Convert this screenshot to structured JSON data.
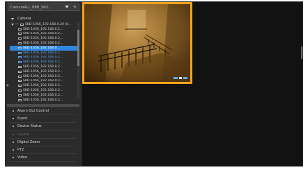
{
  "search": {
    "text": "CameraALL_BBB_SKU..."
  },
  "camera_section": {
    "label": "Camera"
  },
  "tree": {
    "group_label": "SKD-1056_192.168.0.20 (0...",
    "items": [
      {
        "label": "SKD-1056_192.168.0.2...",
        "state": "normal"
      },
      {
        "label": "SKD-1056_192.168.0.2...",
        "state": "normal"
      },
      {
        "label": "SKD-1056_192.168.0.2...",
        "state": "normal"
      },
      {
        "label": "SKD-1056_192.168.0.2...",
        "state": "normal"
      },
      {
        "label": "SKD-1056_192.168.0...",
        "state": "selected"
      },
      {
        "label": "SKD-1056_192.168.0.2...",
        "state": "blue"
      },
      {
        "label": "SKD-1056_192.168.0.2...",
        "state": "blue"
      },
      {
        "label": "SKD-1056_192.168.0.2...",
        "state": "blue"
      },
      {
        "label": "SKD-1056_192.168.0.2...",
        "state": "normal"
      },
      {
        "label": "SKD-1056_192.168.0.2...",
        "state": "normal"
      },
      {
        "label": "SKD-1056_192.168.0.2...",
        "state": "normal"
      },
      {
        "label": "SKD-1056_192.168.0.2...",
        "state": "normal"
      },
      {
        "label": "SKD-1056_192.168.0.2...",
        "state": "normal"
      },
      {
        "label": "SKD-1056_192.168.0.2...",
        "state": "normal"
      },
      {
        "label": "SKD-1056_192.168.0.2...",
        "state": "normal"
      },
      {
        "label": "SKD-1056_192.168.0.2...",
        "state": "normal"
      }
    ]
  },
  "accordion": [
    {
      "label": "Alarm Out Control",
      "disabled": false
    },
    {
      "label": "Event",
      "disabled": false
    },
    {
      "label": "Device Status",
      "disabled": false
    },
    {
      "label": "Layout",
      "disabled": true
    },
    {
      "label": "Digital Zoom",
      "disabled": false
    },
    {
      "label": "PTZ",
      "disabled": false
    },
    {
      "label": "Video",
      "disabled": false
    }
  ],
  "colors": {
    "accent_orange": "#f5a21b",
    "selection_blue": "#2f86df",
    "sidebar_bg": "#2b2b2b",
    "main_bg": "#121212"
  }
}
